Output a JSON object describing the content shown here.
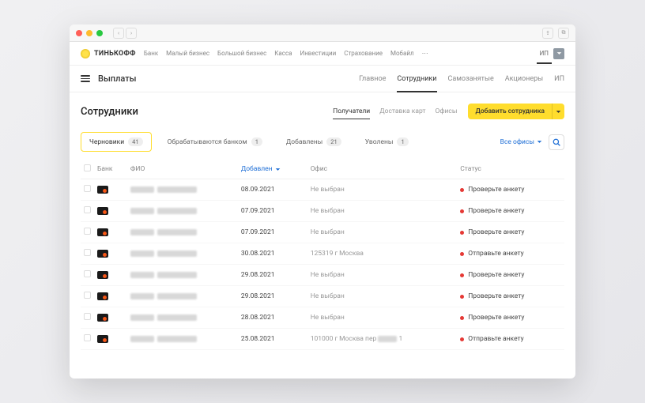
{
  "brand": "ТИНЬКОФФ",
  "topnav": {
    "links": [
      "Банк",
      "Малый бизнес",
      "Большой бизнес",
      "Касса",
      "Инвестиции",
      "Страхование",
      "Мобайл",
      "⋯"
    ],
    "profile_prefix": "ИП"
  },
  "subnav": {
    "title": "Выплаты",
    "tabs": [
      "Главное",
      "Сотрудники",
      "Самозанятые",
      "Акционеры",
      "ИП"
    ],
    "active": 1
  },
  "heading": "Сотрудники",
  "view_tabs": [
    "Получатели",
    "Доставка карт",
    "Офисы"
  ],
  "view_active": 0,
  "add_button": "Добавить сотрудника",
  "status_tabs": [
    {
      "label": "Черновики",
      "count": 41,
      "active": true
    },
    {
      "label": "Обрабатываются банком",
      "count": 1
    },
    {
      "label": "Добавлены",
      "count": 21
    },
    {
      "label": "Уволены",
      "count": 1
    }
  ],
  "office_filter": "Все офисы",
  "columns": {
    "bank": "Банк",
    "fio": "ФИО",
    "added": "Добавлен",
    "office": "Офис",
    "status": "Статус"
  },
  "rows": [
    {
      "date": "08.09.2021",
      "office": "Не выбран",
      "status": "Проверьте анкету",
      "dot": "red"
    },
    {
      "date": "07.09.2021",
      "office": "Не выбран",
      "status": "Проверьте анкету",
      "dot": "red"
    },
    {
      "date": "07.09.2021",
      "office": "Не выбран",
      "status": "Проверьте анкету",
      "dot": "red"
    },
    {
      "date": "30.08.2021",
      "office": "125319 г Москва",
      "status": "Отправьте анкету",
      "dot": "red"
    },
    {
      "date": "29.08.2021",
      "office": "Не выбран",
      "status": "Проверьте анкету",
      "dot": "red"
    },
    {
      "date": "29.08.2021",
      "office": "Не выбран",
      "status": "Проверьте анкету",
      "dot": "red"
    },
    {
      "date": "28.08.2021",
      "office": "Не выбран",
      "status": "Проверьте анкету",
      "dot": "red"
    },
    {
      "date": "25.08.2021",
      "office": "101000 г Москва пер ▒▒▒ 1",
      "status": "Отправьте анкету",
      "dot": "red"
    }
  ]
}
